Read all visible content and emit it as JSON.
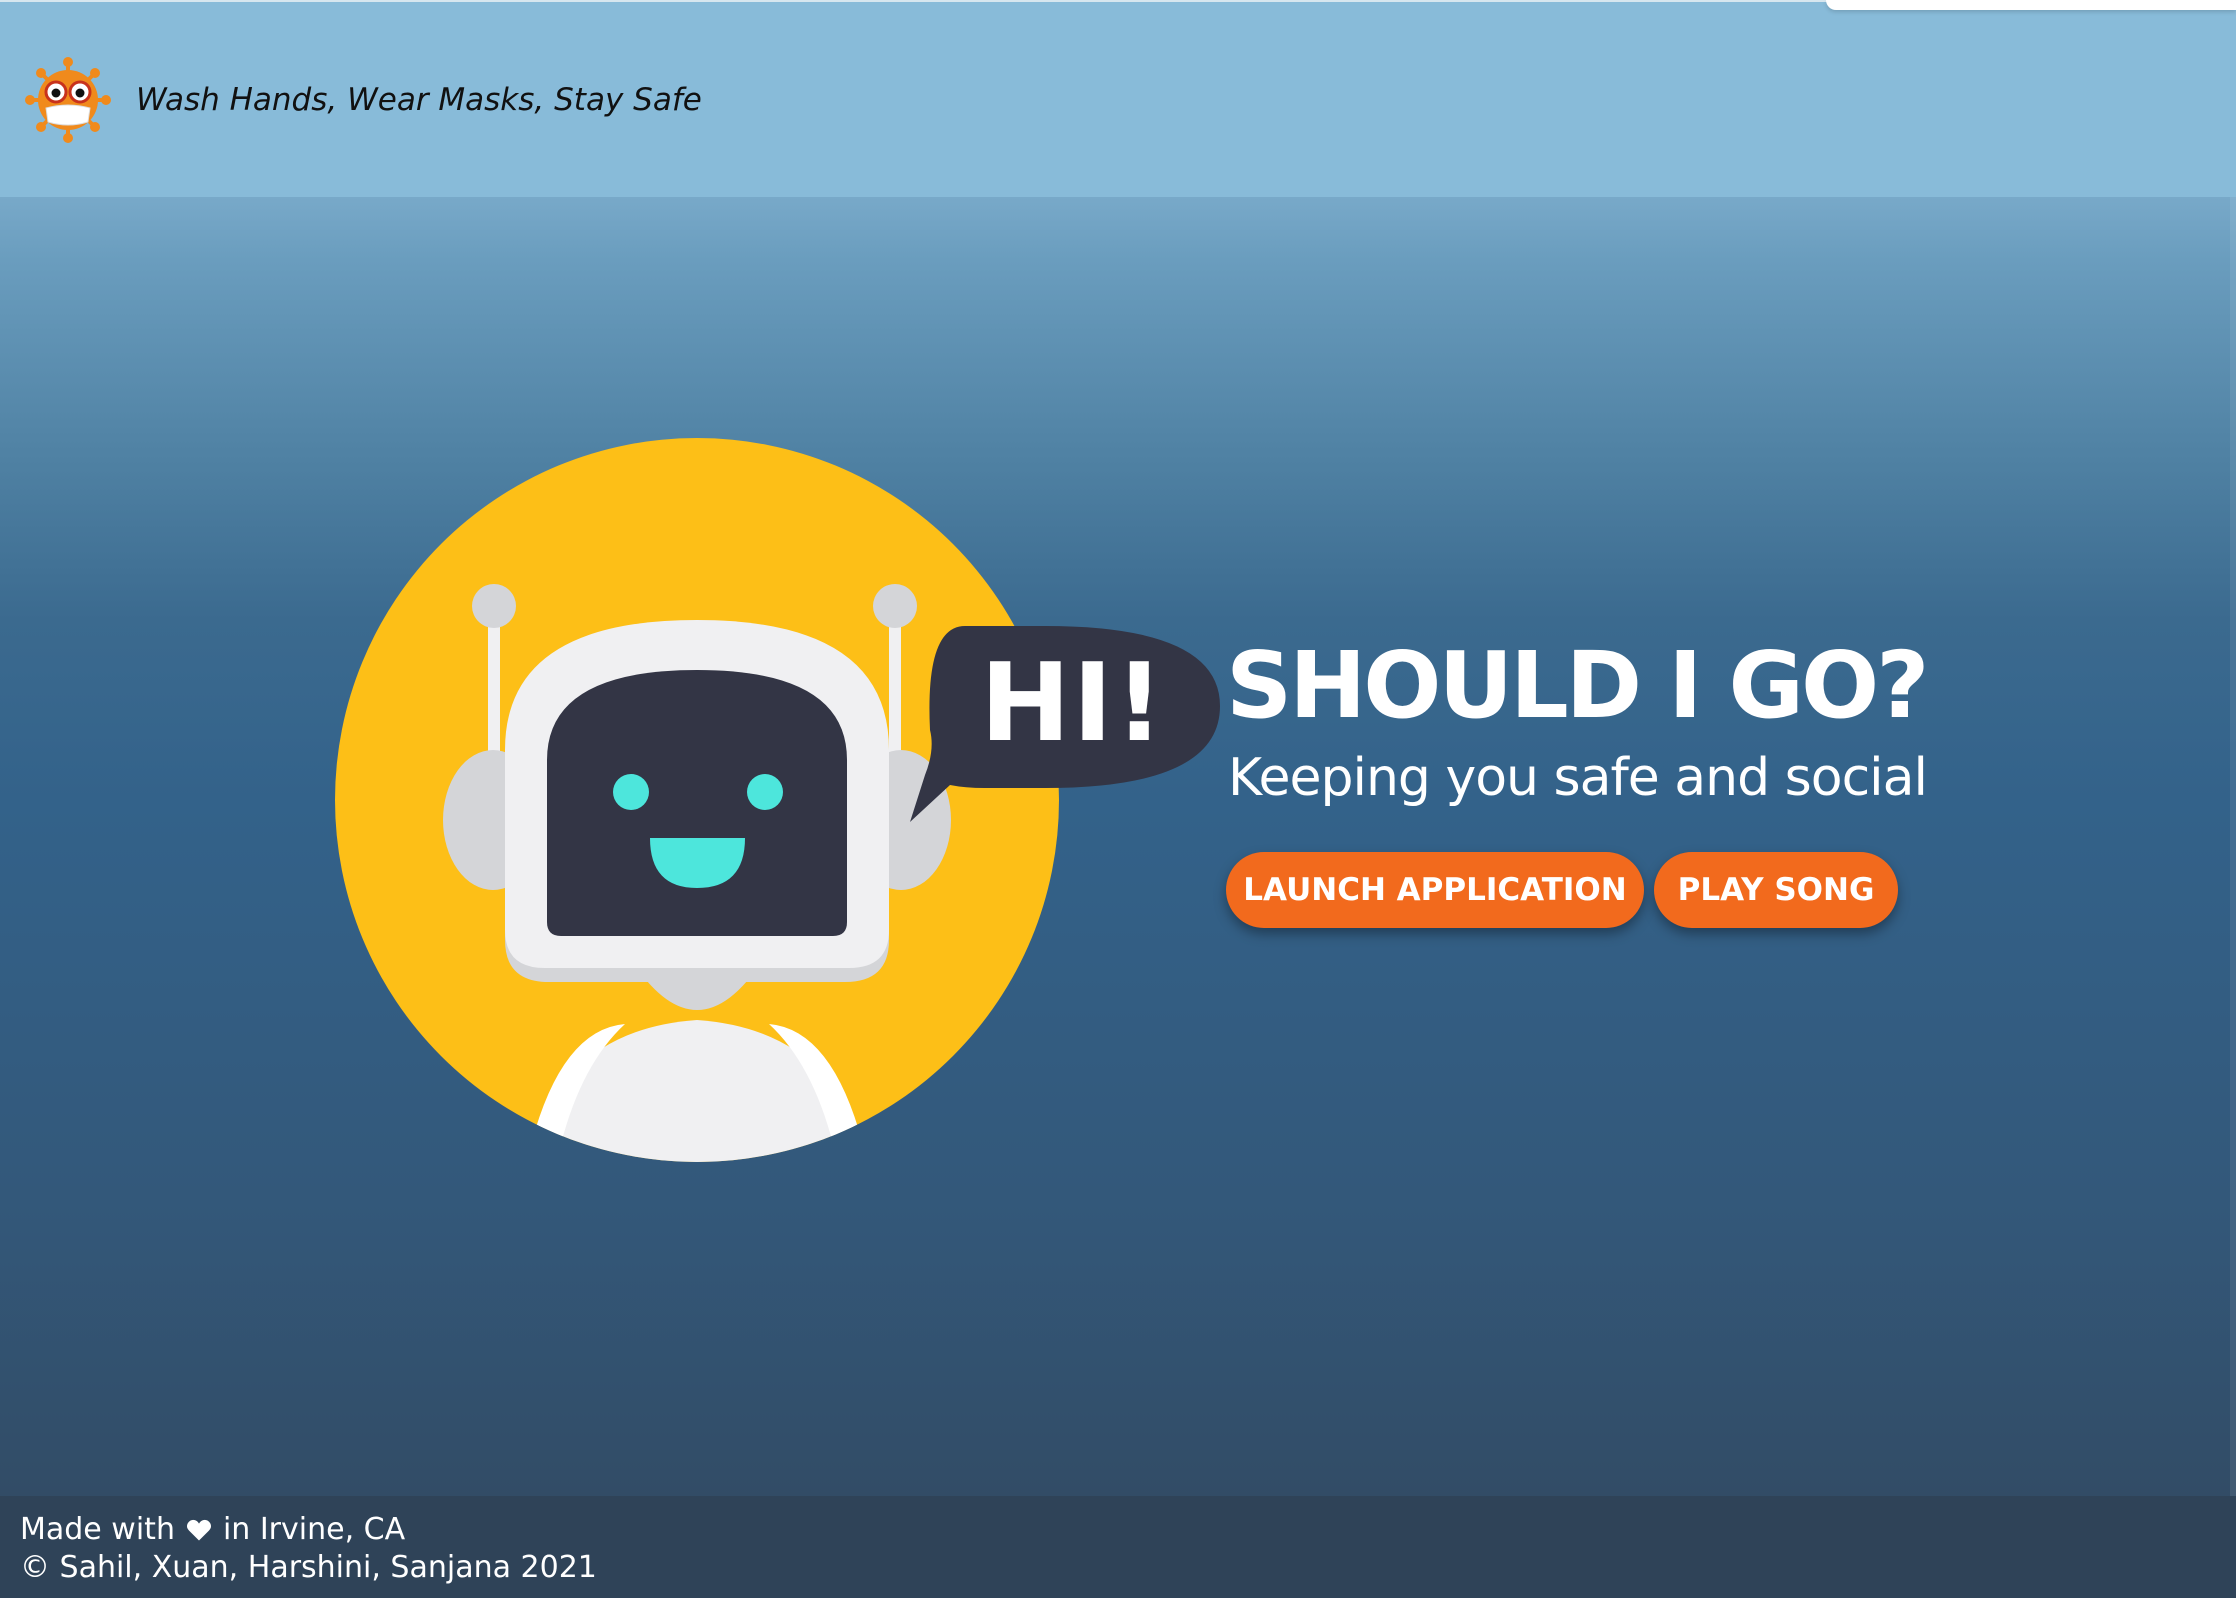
{
  "header": {
    "tagline": "Wash Hands, Wear Masks, Stay Safe",
    "logo_icon": "virus-mascot-icon"
  },
  "hero": {
    "speech_bubble": "HI!",
    "title": "SHOULD I GO?",
    "subtitle": "Keeping you safe and social",
    "buttons": {
      "launch_label": "LAUNCH APPLICATION",
      "song_label": "PLAY SONG"
    }
  },
  "footer": {
    "made_with_prefix": "Made with",
    "made_with_suffix": "in Irvine, CA",
    "copyright": "© Sahil, Xuan, Harshini, Sanjana 2021"
  },
  "colors": {
    "header_bg": "#88bbd9",
    "button": "#f26a1d",
    "robot_circle": "#fdbf17",
    "robot_face": "#333545",
    "robot_eyes": "#4de6dc"
  }
}
